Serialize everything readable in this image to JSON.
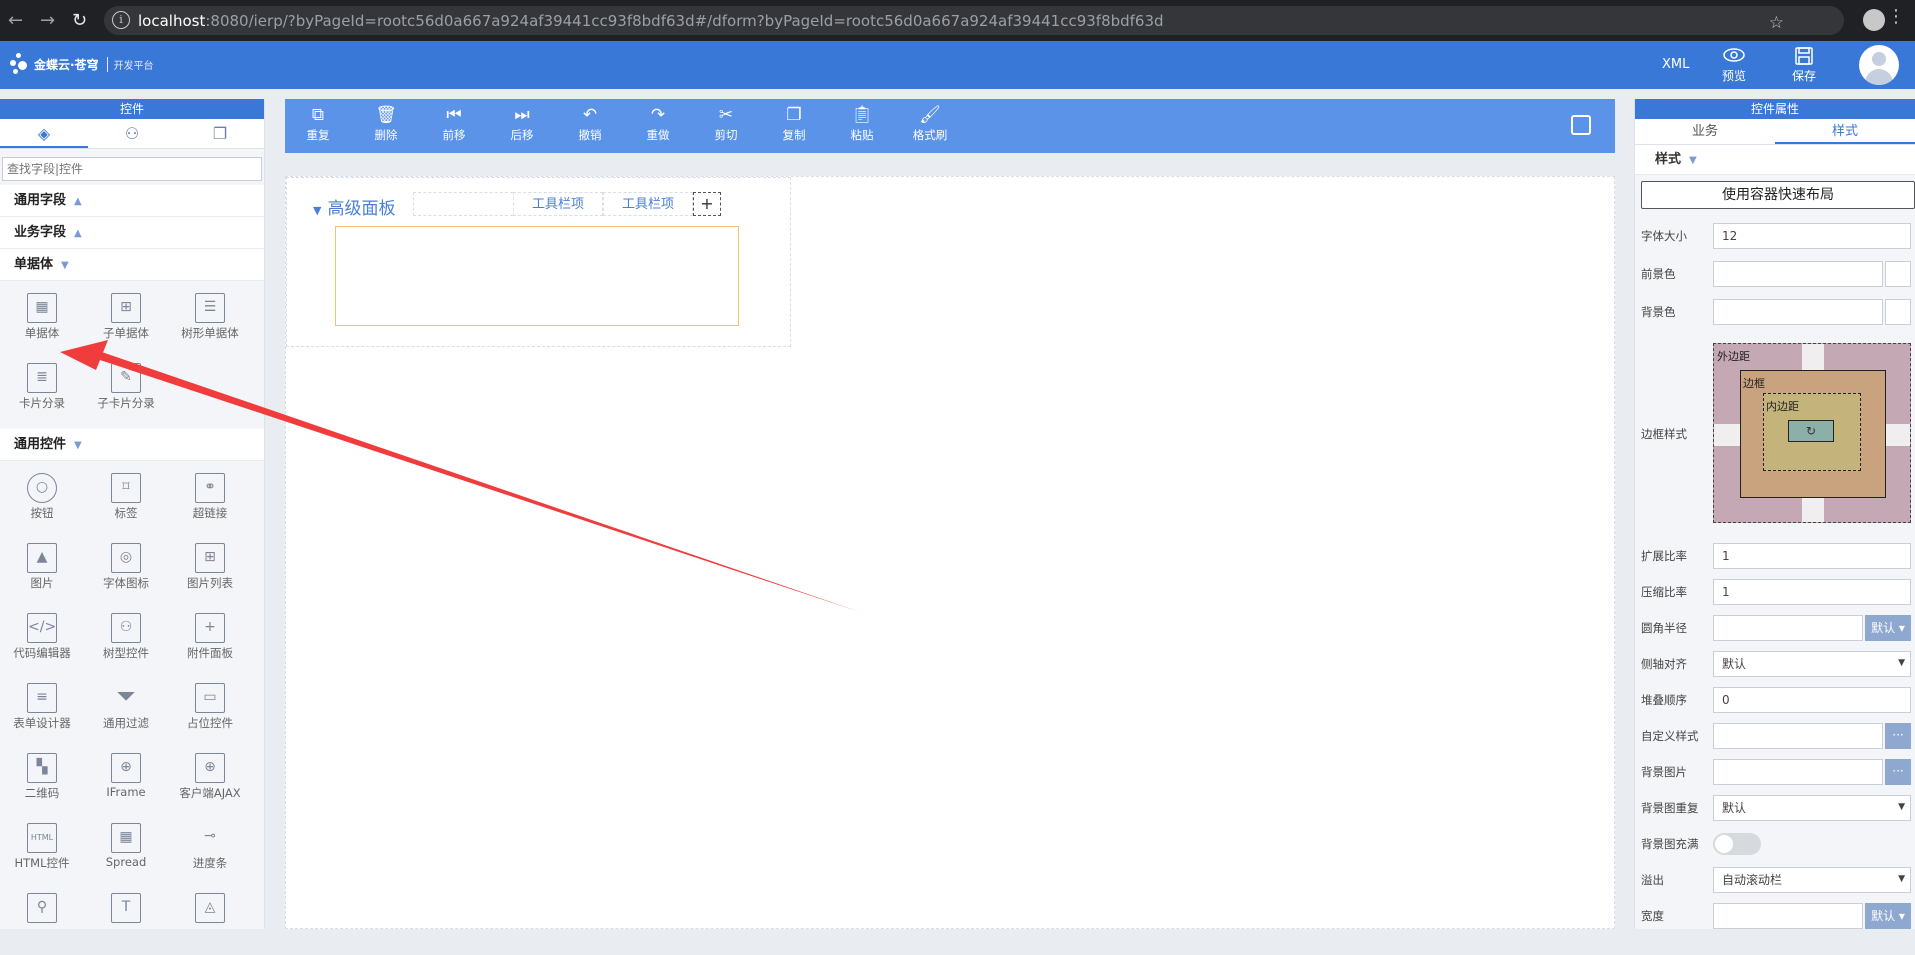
{
  "browser": {
    "url_host": "localhost",
    "url_rest": ":8080/ierp/?byPageId=rootc56d0a667a924af39441cc93f8bdf63d#/dform?byPageId=rootc56d0a667a924af39441cc93f8bdf63d"
  },
  "header": {
    "brand": "金蝶云·苍穹",
    "sub": "开发平台",
    "xml_label": "XML",
    "preview_label": "预览",
    "save_label": "保存"
  },
  "left_panel": {
    "title": "控件",
    "search_placeholder": "查找字段|控件",
    "sections": {
      "common_fields": "通用字段",
      "business_fields": "业务字段",
      "single_entity": "单据体",
      "common_controls": "通用控件"
    },
    "entity_items": [
      "单据体",
      "子单据体",
      "树形单据体",
      "卡片分录",
      "子卡片分录"
    ],
    "control_items": [
      "按钮",
      "标签",
      "超链接",
      "图片",
      "字体图标",
      "图片列表",
      "代码编辑器",
      "树型控件",
      "附件面板",
      "表单设计器",
      "通用过滤",
      "占位控件",
      "二维码",
      "IFrame",
      "客户端AJAX",
      "HTML控件",
      "Spread",
      "进度条"
    ]
  },
  "toolbar": {
    "items": [
      "重复",
      "删除",
      "前移",
      "后移",
      "撤销",
      "重做",
      "剪切",
      "复制",
      "粘贴",
      "格式刷"
    ]
  },
  "canvas": {
    "panel_title": "高级面板",
    "toolbar_item_1": "工具栏项",
    "toolbar_item_2": "工具栏项",
    "add_label": "+"
  },
  "right_panel": {
    "title": "控件属性",
    "tab_business": "业务",
    "tab_style": "样式",
    "style_header": "样式",
    "quick_layout": "使用容器快速布局",
    "props": {
      "font_size_label": "字体大小",
      "font_size_value": "12",
      "fg_label": "前景色",
      "bg_label": "背景色",
      "border_style_label": "边框样式",
      "margin_label": "外边距",
      "border_label": "边框",
      "padding_label": "内边距",
      "grow_label": "扩展比率",
      "grow_value": "1",
      "shrink_label": "压缩比率",
      "shrink_value": "1",
      "radius_label": "圆角半径",
      "radius_default": "默认 ▾",
      "cross_align_label": "侧轴对齐",
      "cross_align_value": "默认",
      "zindex_label": "堆叠顺序",
      "zindex_value": "0",
      "custom_style_label": "自定义样式",
      "bg_image_label": "背景图片",
      "bg_repeat_label": "背景图重复",
      "bg_repeat_value": "默认",
      "bg_fill_label": "背景图充满",
      "overflow_label": "溢出",
      "overflow_value": "自动滚动栏",
      "width_label": "宽度",
      "width_default": "默认 ▾"
    }
  },
  "colors": {
    "header_blue": "#3a78d8",
    "toolbar_blue": "#5b93e8",
    "arrow_red": "#f03c3c"
  }
}
